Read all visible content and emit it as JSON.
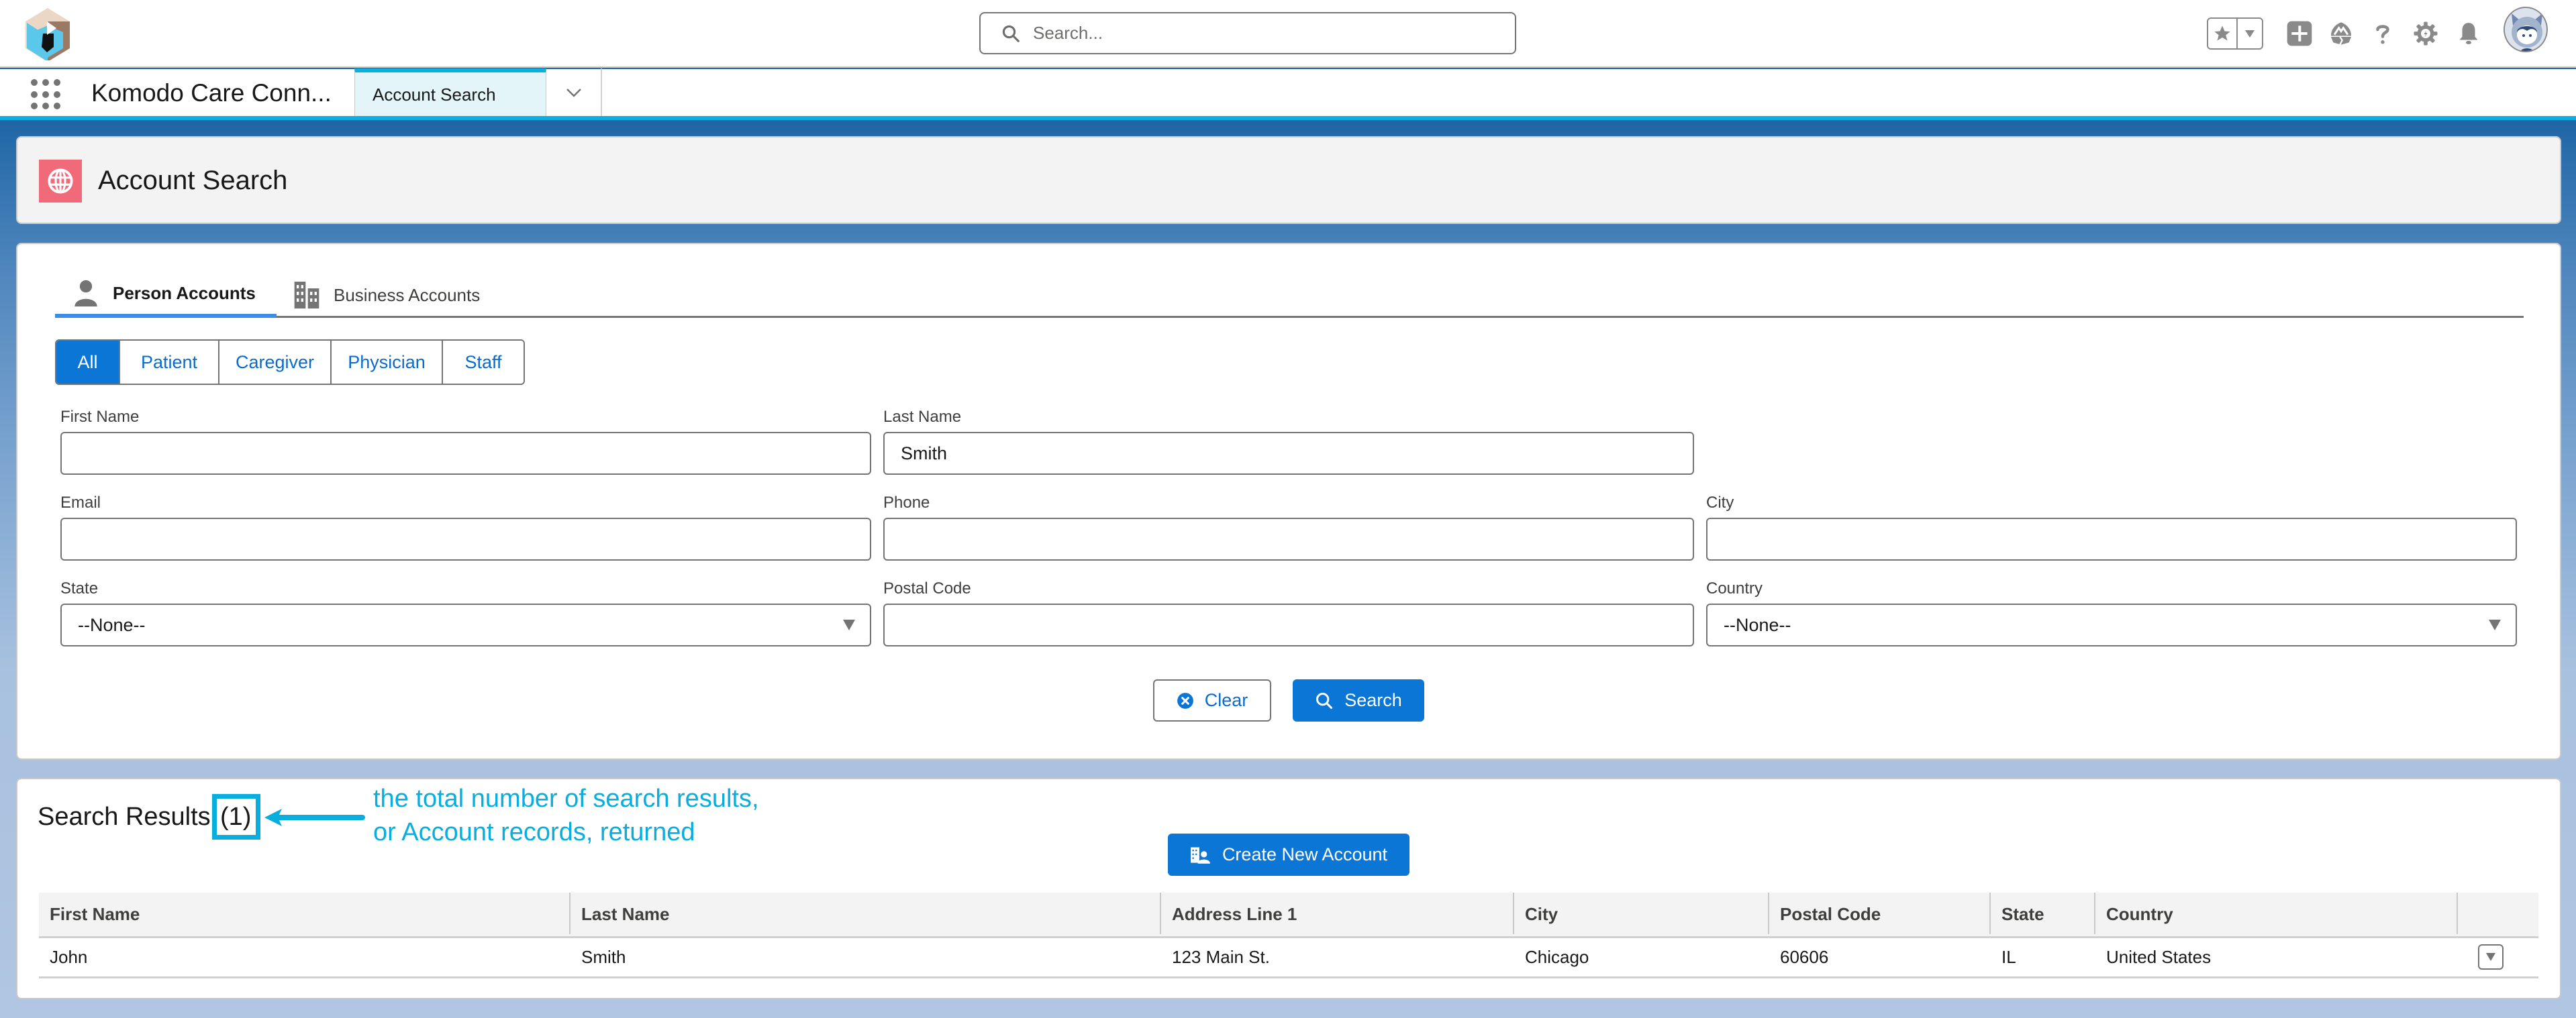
{
  "global_header": {
    "search_placeholder": "Search...",
    "icons": [
      "star-favorites-icon",
      "favorites-dropdown-icon",
      "global-add-icon",
      "trailhead-icon",
      "help-icon",
      "setup-gear-icon",
      "notifications-bell-icon",
      "user-avatar"
    ]
  },
  "nav": {
    "app_name": "Komodo Care Conn...",
    "tabs": [
      {
        "label": "Account Search",
        "active": true
      }
    ]
  },
  "page_header": {
    "title": "Account Search",
    "icon": "globe-icon",
    "icon_color": "#f06a7a"
  },
  "account_tabs": [
    {
      "label": "Person Accounts",
      "active": true,
      "icon": "person-icon"
    },
    {
      "label": "Business Accounts",
      "active": false,
      "icon": "building-icon"
    }
  ],
  "record_type_filter": {
    "options": [
      "All",
      "Patient",
      "Caregiver",
      "Physician",
      "Staff"
    ],
    "selected": "All"
  },
  "form": {
    "first_name": {
      "label": "First Name",
      "value": ""
    },
    "last_name": {
      "label": "Last Name",
      "value": "Smith"
    },
    "email": {
      "label": "Email",
      "value": ""
    },
    "phone": {
      "label": "Phone",
      "value": ""
    },
    "city": {
      "label": "City",
      "value": ""
    },
    "state": {
      "label": "State",
      "value": "--None--"
    },
    "postal_code": {
      "label": "Postal Code",
      "value": ""
    },
    "country": {
      "label": "Country",
      "value": "--None--"
    },
    "clear_label": "Clear",
    "search_label": "Search"
  },
  "results": {
    "title": "Search Results",
    "count": "(1)",
    "annotation_line1": "the total number of search results,",
    "annotation_line2": "or Account records, returned",
    "create_label": "Create New Account",
    "columns": [
      "First Name",
      "Last Name",
      "Address Line 1",
      "City",
      "Postal Code",
      "State",
      "Country",
      ""
    ],
    "rows": [
      [
        "John",
        "Smith",
        "123 Main St.",
        "Chicago",
        "60606",
        "IL",
        "United States"
      ]
    ]
  },
  "colors": {
    "brand_blue": "#0b76d6",
    "annotation_cyan": "#09aede",
    "nav_accent": "#0bb0e0"
  }
}
